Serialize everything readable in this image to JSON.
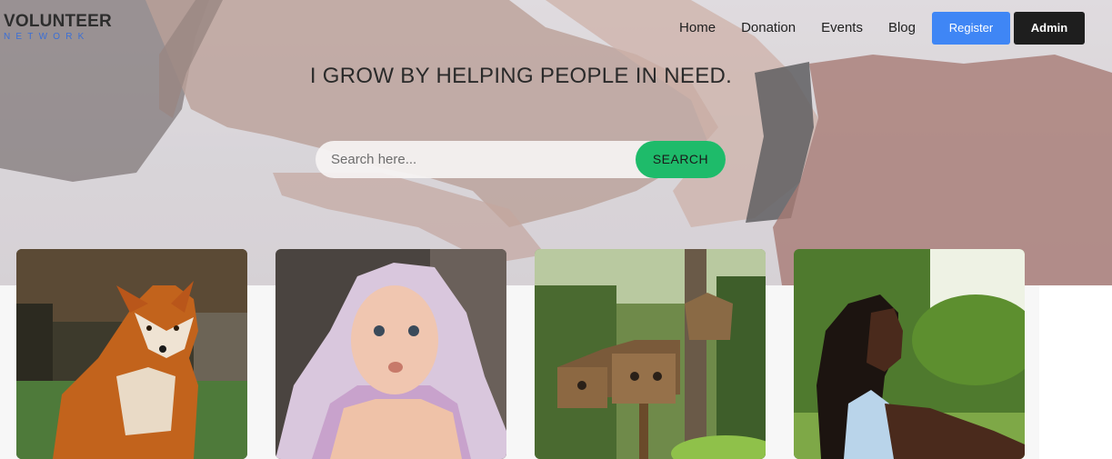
{
  "logo": {
    "main": "VOLUNTEER",
    "sub": "NETWORK"
  },
  "nav": {
    "links": [
      "Home",
      "Donation",
      "Events",
      "Blog"
    ],
    "register_label": "Register",
    "admin_label": "Admin"
  },
  "hero": {
    "headline": "I GROW BY HELPING PEOPLE IN NEED.",
    "search_placeholder": "Search here...",
    "search_button": "SEARCH"
  },
  "cards": [
    {
      "image": "fox-photo"
    },
    {
      "image": "baby-photo"
    },
    {
      "image": "birdhouse-photo"
    },
    {
      "image": "girl-photo"
    }
  ],
  "colors": {
    "register": "#3f86f5",
    "admin": "#1e1e1e",
    "search_button": "#1ebb6a",
    "logo_sub": "#3b6fd6"
  }
}
